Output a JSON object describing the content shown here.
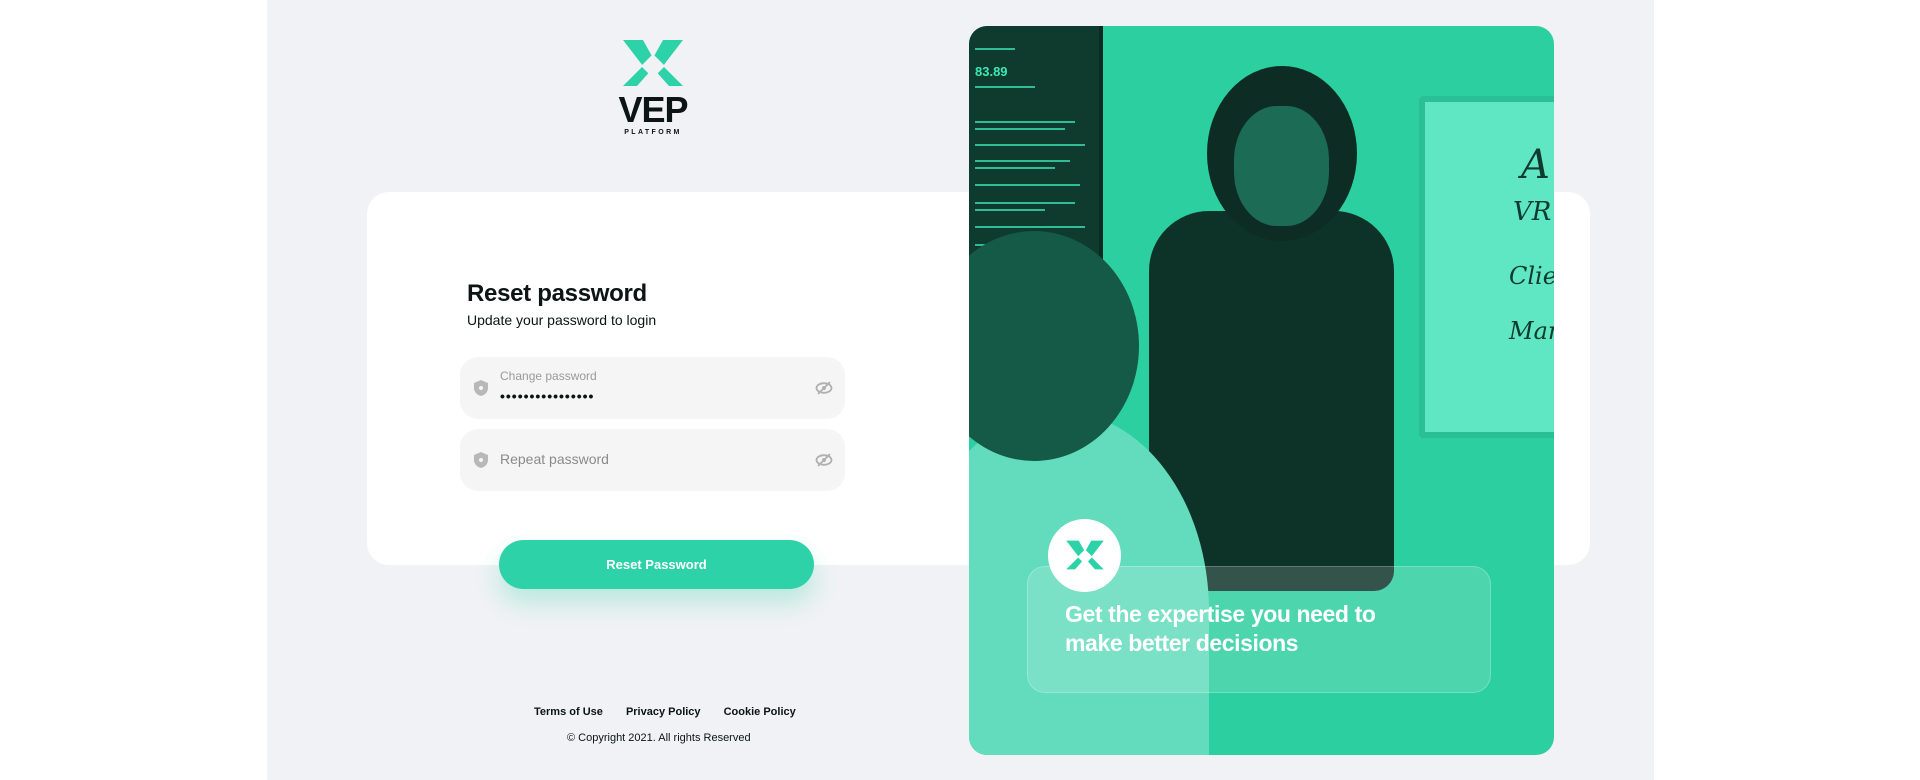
{
  "brand": {
    "name": "VEP",
    "tagline": "PLATFORM",
    "accent_color": "#2dd2a8"
  },
  "form": {
    "title": "Reset password",
    "subtitle": "Update your password to login",
    "new_password": {
      "label": "Change password",
      "value": "••••••••••••••••",
      "icon": "shield-icon",
      "toggle_icon": "eye-off-icon"
    },
    "repeat_password": {
      "placeholder": "Repeat password",
      "icon": "shield-icon",
      "toggle_icon": "eye-off-icon"
    },
    "submit_label": "Reset Password"
  },
  "footer": {
    "links": [
      "Terms of Use",
      "Privacy Policy",
      "Cookie Policy"
    ],
    "copyright": "© Copyright 2021. All rights Reserved"
  },
  "hero": {
    "headline": "Get the expertise you need to make better decisions",
    "screen_price": "83.89",
    "board_words": [
      "A",
      "VR",
      "Clien",
      "Mark"
    ]
  }
}
